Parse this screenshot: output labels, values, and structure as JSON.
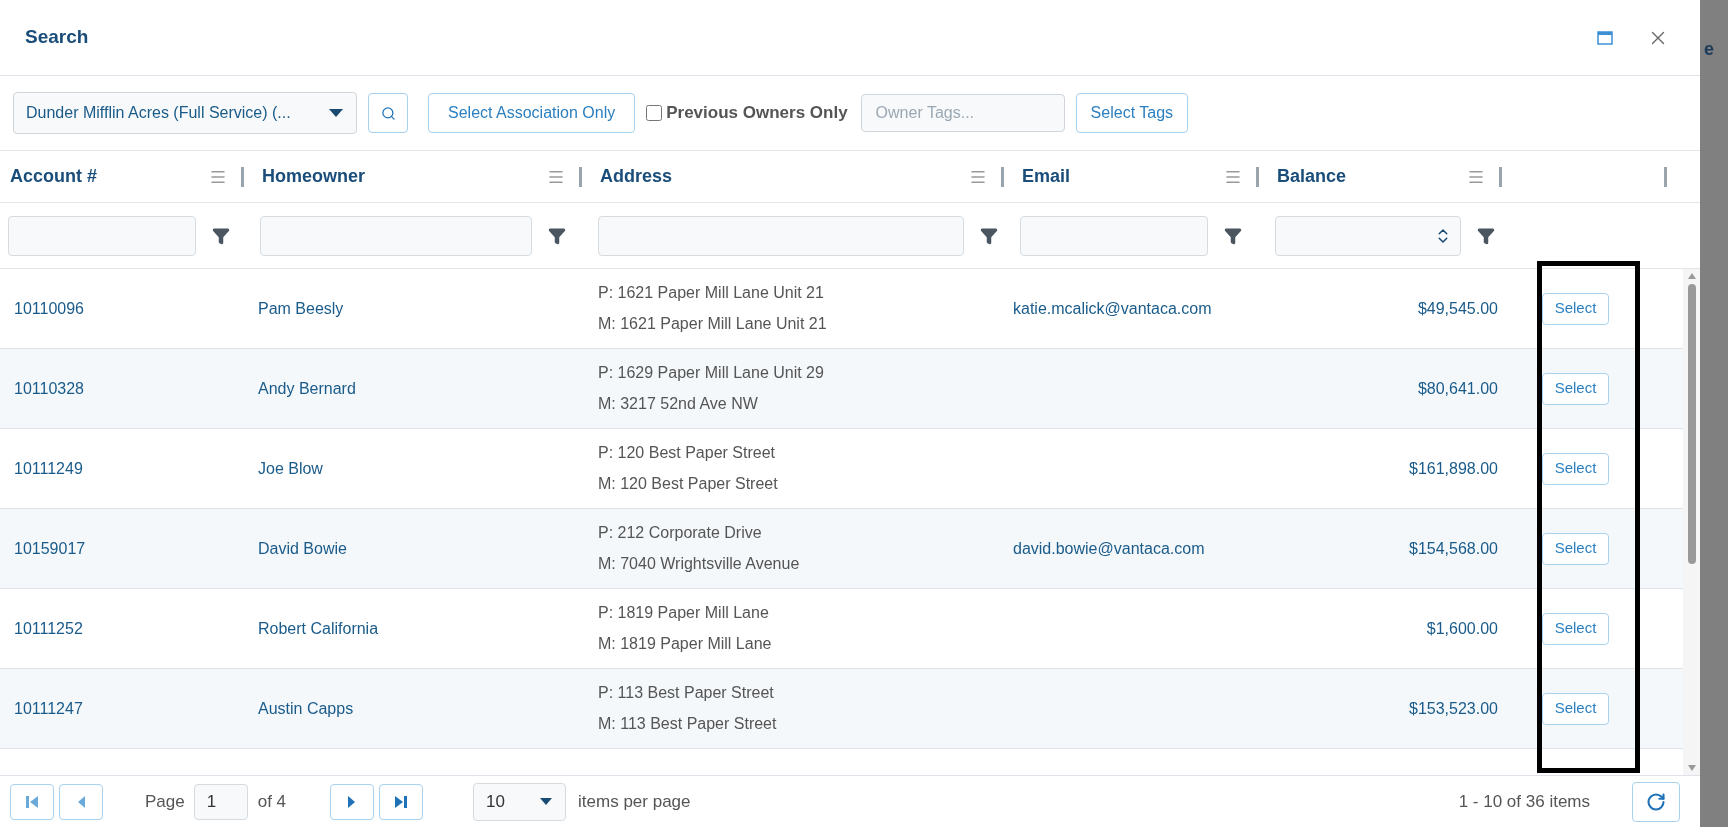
{
  "dialog": {
    "title": "Search"
  },
  "toolbar": {
    "association": "Dunder Mifflin Acres (Full Service) (...",
    "association_button": "Select Association Only",
    "previous_owners": {
      "label": "Previous Owners Only",
      "checked": false
    },
    "tags": {
      "placeholder": "Owner Tags..."
    },
    "tags_button": "Select Tags"
  },
  "table": {
    "columns": [
      "Account #",
      "Homeowner",
      "Address",
      "Email",
      "Balance"
    ],
    "rows": [
      {
        "account": "10110096",
        "homeowner": "Pam Beesly",
        "address": [
          "P: 1621 Paper Mill Lane Unit 21",
          "M: 1621 Paper Mill Lane Unit 21"
        ],
        "email": "katie.mcalick@vantaca.com",
        "balance": "$49,545.00",
        "action": "Select"
      },
      {
        "account": "10110328",
        "homeowner": "Andy Bernard",
        "address": [
          "P: 1629 Paper Mill Lane Unit 29",
          "M: 3217 52nd Ave NW"
        ],
        "balance": "$80,641.00",
        "action": "Select"
      },
      {
        "account": "10111249",
        "homeowner": "Joe Blow",
        "address": [
          "P: 120 Best Paper Street",
          "M: 120 Best Paper Street"
        ],
        "balance": "$161,898.00",
        "action": "Select"
      },
      {
        "account": "10159017",
        "homeowner": "David Bowie",
        "address": [
          "P: 212 Corporate Drive",
          "M: 7040 Wrightsville Avenue"
        ],
        "email": "david.bowie@vantaca.com",
        "balance": "$154,568.00",
        "action": "Select"
      },
      {
        "account": "10111252",
        "homeowner": "Robert California",
        "address": [
          "P: 1819 Paper Mill Lane",
          "M: 1819 Paper Mill Lane"
        ],
        "balance": "$1,600.00",
        "action": "Select"
      },
      {
        "account": "10111247",
        "homeowner": "Austin Capps",
        "address": [
          "P: 113 Best Paper Street",
          "M: 113 Best Paper Street"
        ],
        "balance": "$153,523.00",
        "action": "Select"
      }
    ]
  },
  "pager": {
    "page_label": "Page",
    "page": "1",
    "of": "of 4",
    "page_size": "10",
    "page_size_label": "items per page",
    "summary": "1 - 10 of 36 items"
  },
  "backdrop": {
    "text": "e"
  }
}
